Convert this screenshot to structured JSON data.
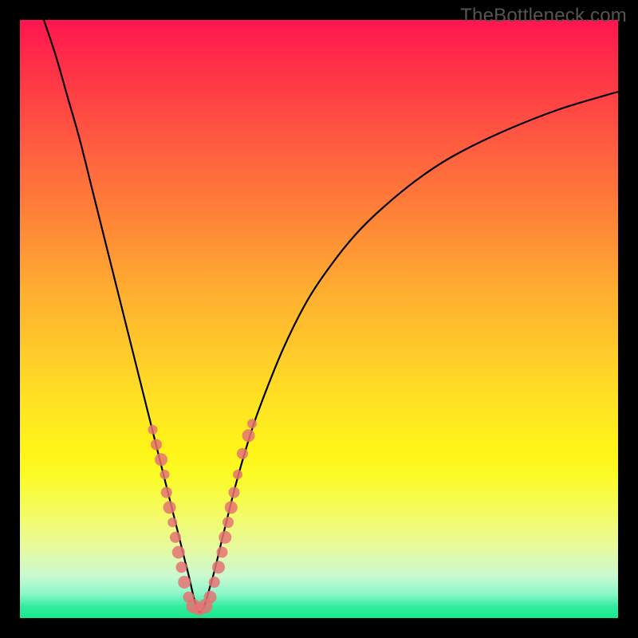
{
  "watermark": "TheBottleneck.com",
  "chart_data": {
    "type": "line",
    "title": "",
    "xlabel": "",
    "ylabel": "",
    "xlim": [
      0,
      100
    ],
    "ylim": [
      0,
      100
    ],
    "curve": {
      "name": "bottleneck-curve",
      "minimum_x": 30,
      "x": [
        4,
        6,
        8,
        10,
        12,
        14,
        16,
        18,
        20,
        22,
        24,
        26,
        28,
        30,
        32,
        34,
        36,
        38,
        40,
        44,
        48,
        52,
        56,
        60,
        66,
        72,
        80,
        90,
        100
      ],
      "y": [
        100,
        94,
        87,
        80,
        72,
        64,
        56,
        48,
        40,
        32,
        24,
        16,
        8,
        1,
        6,
        14,
        22,
        29,
        35,
        45,
        53,
        59,
        64,
        68,
        73,
        77,
        81,
        85,
        88
      ]
    },
    "scatter": {
      "name": "data-points",
      "color": "#e57373",
      "radius_range": [
        5,
        10
      ],
      "points": [
        {
          "x": 22.2,
          "y": 31.5,
          "r": 6
        },
        {
          "x": 22.8,
          "y": 29.0,
          "r": 7
        },
        {
          "x": 23.6,
          "y": 26.5,
          "r": 8
        },
        {
          "x": 24.2,
          "y": 24.0,
          "r": 6
        },
        {
          "x": 24.5,
          "y": 21.0,
          "r": 7
        },
        {
          "x": 25.0,
          "y": 18.5,
          "r": 8
        },
        {
          "x": 25.5,
          "y": 16.0,
          "r": 6
        },
        {
          "x": 26.0,
          "y": 13.5,
          "r": 7
        },
        {
          "x": 26.5,
          "y": 11.0,
          "r": 8
        },
        {
          "x": 27.0,
          "y": 8.5,
          "r": 7
        },
        {
          "x": 27.5,
          "y": 6.0,
          "r": 8
        },
        {
          "x": 28.2,
          "y": 3.5,
          "r": 7
        },
        {
          "x": 29.0,
          "y": 2.0,
          "r": 9
        },
        {
          "x": 30.0,
          "y": 1.5,
          "r": 8
        },
        {
          "x": 31.0,
          "y": 2.0,
          "r": 9
        },
        {
          "x": 31.8,
          "y": 3.5,
          "r": 8
        },
        {
          "x": 32.5,
          "y": 6.0,
          "r": 7
        },
        {
          "x": 33.2,
          "y": 8.5,
          "r": 8
        },
        {
          "x": 33.8,
          "y": 11.0,
          "r": 7
        },
        {
          "x": 34.3,
          "y": 13.5,
          "r": 8
        },
        {
          "x": 34.8,
          "y": 16.0,
          "r": 7
        },
        {
          "x": 35.3,
          "y": 18.5,
          "r": 8
        },
        {
          "x": 35.8,
          "y": 21.0,
          "r": 7
        },
        {
          "x": 36.4,
          "y": 24.0,
          "r": 6
        },
        {
          "x": 37.2,
          "y": 27.5,
          "r": 7
        },
        {
          "x": 38.2,
          "y": 30.5,
          "r": 8
        },
        {
          "x": 38.8,
          "y": 32.5,
          "r": 6
        }
      ]
    },
    "gradient_stops": [
      {
        "pos": 0,
        "color": "#ff1550"
      },
      {
        "pos": 50,
        "color": "#ffc028"
      },
      {
        "pos": 80,
        "color": "#fff860"
      },
      {
        "pos": 100,
        "color": "#15e888"
      }
    ]
  }
}
